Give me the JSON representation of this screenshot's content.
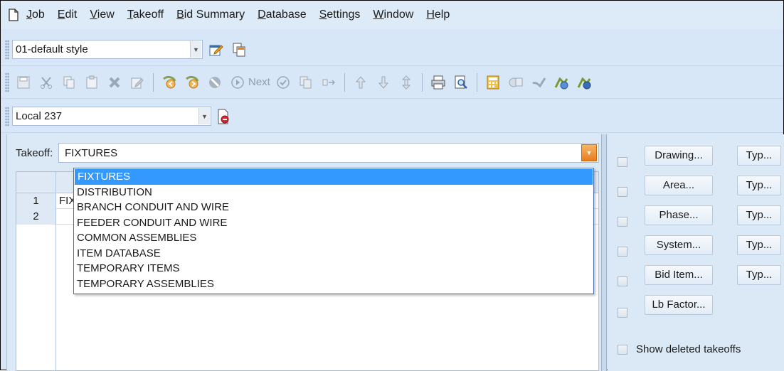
{
  "menu": {
    "items": [
      {
        "label_u": "J",
        "label_rest": "ob"
      },
      {
        "label_u": "E",
        "label_rest": "dit"
      },
      {
        "label_u": "V",
        "label_rest": "iew"
      },
      {
        "label_u": "T",
        "label_rest": "akeoff"
      },
      {
        "label_u": "B",
        "label_rest": "id Summary"
      },
      {
        "label_u": "D",
        "label_rest": "atabase"
      },
      {
        "label_u": "S",
        "label_rest": "ettings"
      },
      {
        "label_u": "W",
        "label_rest": "indow"
      },
      {
        "label_u": "H",
        "label_rest": "elp"
      }
    ]
  },
  "toolbar1": {
    "style_value": "01-default style"
  },
  "toolbar2": {
    "next_label": "Next"
  },
  "toolbar3": {
    "labor_value": "Local 237"
  },
  "takeoff": {
    "label": "Takeoff:",
    "value": "FIXTURES",
    "options": [
      "FIXTURES",
      "DISTRIBUTION",
      "BRANCH CONDUIT AND WIRE",
      "FEEDER CONDUIT AND WIRE",
      "COMMON ASSEMBLIES",
      "ITEM DATABASE",
      "TEMPORARY ITEMS",
      "TEMPORARY ASSEMBLIES"
    ],
    "selected_index": 0
  },
  "grid": {
    "rows": [
      {
        "num": "1",
        "text": "FIX"
      },
      {
        "num": "2",
        "text": ""
      }
    ]
  },
  "filters": {
    "drawing": "Drawing...",
    "area": "Area...",
    "phase": "Phase...",
    "system": "System...",
    "bid_item": "Bid Item...",
    "lb_factor": "Lb Factor...",
    "type": "Typ...",
    "show_deleted": "Show deleted takeoffs"
  },
  "colors": {
    "selection": "#3399ff",
    "background": "#dbe8f6",
    "accent": "#e87d1f"
  }
}
